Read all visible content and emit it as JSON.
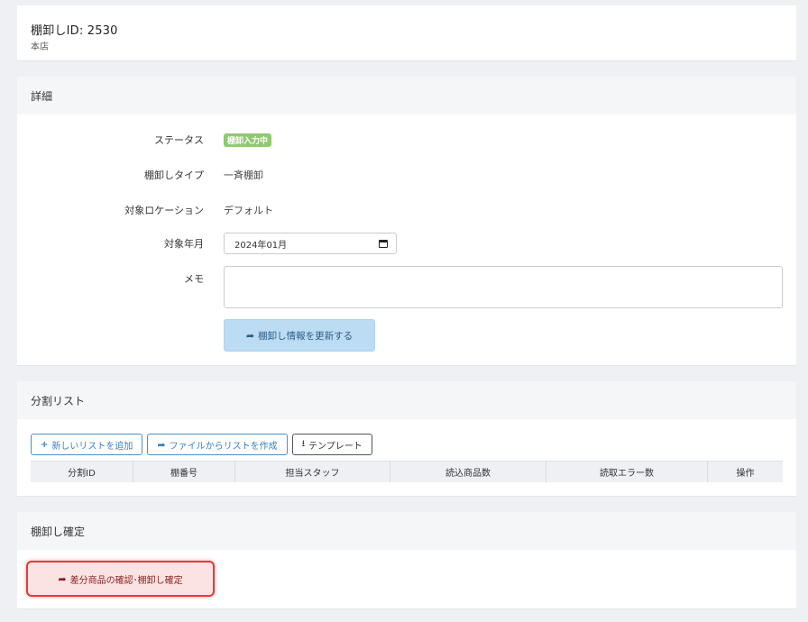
{
  "header": {
    "title": "棚卸しID: 2530",
    "subtitle": "本店"
  },
  "detail": {
    "heading": "詳細",
    "status_label": "ステータス",
    "status_value": "棚卸入力中",
    "type_label": "棚卸しタイプ",
    "type_value": "一斉棚卸",
    "location_label": "対象ロケーション",
    "location_value": "デフォルト",
    "month_label": "対象年月",
    "month_value": "2024年01月",
    "memo_label": "メモ",
    "memo_value": "",
    "update_button": "棚卸し情報を更新する"
  },
  "split_list": {
    "heading": "分割リスト",
    "buttons": {
      "add": "新しいリストを追加",
      "from_file": "ファイルからリストを作成",
      "template": "テンプレート"
    },
    "columns": [
      "分割ID",
      "棚番号",
      "担当スタッフ",
      "読込商品数",
      "読取エラー数",
      "操作"
    ]
  },
  "confirm": {
    "heading": "棚卸し確定",
    "button": "差分商品の確認･棚卸し確定"
  },
  "colors": {
    "status_badge": "#8fca6f",
    "primary": "#3a7fbd",
    "danger": "#e23b3b"
  }
}
